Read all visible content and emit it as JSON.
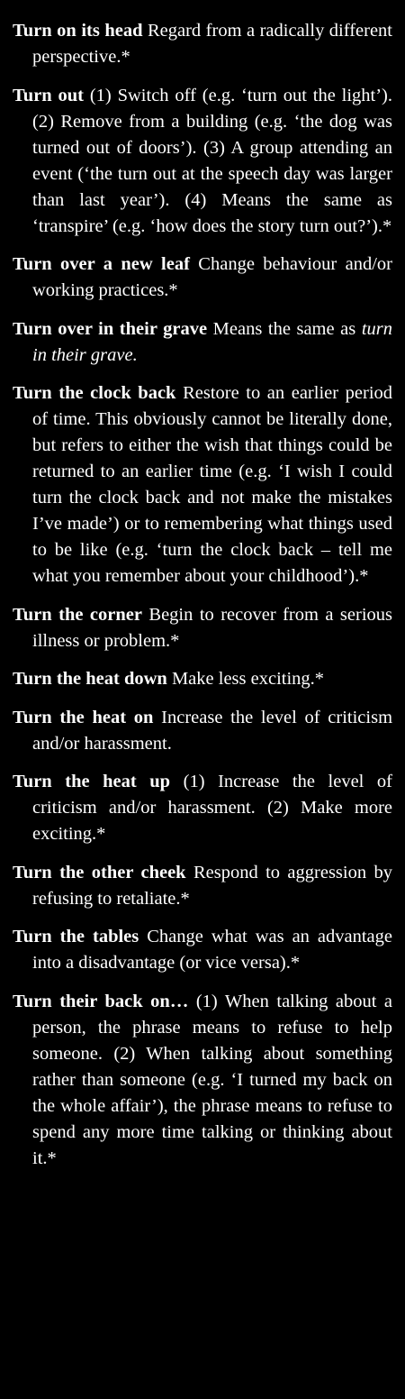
{
  "entries": [
    {
      "term": "Turn on its head",
      "definition": "Regard from a radically different perspective.*"
    },
    {
      "term": "Turn out",
      "definition": "(1) Switch off (e.g. ‘turn out the light’). (2) Remove from a building (e.g. ‘the dog was turned out of doors’). (3) A group attending an event (‘the turn out at the speech day was larger than last year’). (4) Means the same as ‘transpire’ (e.g. ‘how does the story turn out?’).*"
    },
    {
      "term": "Turn over a new leaf",
      "definition": "Change behaviour and/or working practices.*"
    },
    {
      "term": "Turn over in their grave",
      "definition": "Means the same as",
      "definition_italic": "turn in their grave.",
      "definition_after": ""
    },
    {
      "term": "Turn the clock back",
      "definition": "Restore to an earlier period of time. This obviously cannot be literally done, but refers to either the wish that things could be returned to an earlier time (e.g. ‘I wish I could turn the clock back and not make the mistakes I’ve made’) or to remembering what things used to be like (e.g. ‘turn the clock back – tell me what you remember about your childhood’).*"
    },
    {
      "term": "Turn the corner",
      "definition": "Begin to recover from a serious illness or problem.*"
    },
    {
      "term": "Turn the heat down",
      "definition": "Make less exciting.*"
    },
    {
      "term": "Turn the heat on",
      "definition": "Increase the level of criticism and/or harassment."
    },
    {
      "term": "Turn the heat up",
      "definition": "(1) Increase the level of criticism and/or harassment. (2) Make more exciting.*"
    },
    {
      "term": "Turn the other cheek",
      "definition": "Respond to aggression by refusing to retaliate.*"
    },
    {
      "term": "Turn the tables",
      "definition": "Change what was an advantage into a disadvantage (or vice versa).*"
    },
    {
      "term": "Turn their back on…",
      "definition": "(1) When talking about a person, the phrase means to refuse to help someone. (2) When talking about something rather than someone (e.g. ‘I turned my back on the whole affair’), the phrase means to refuse to spend any more time talking or thinking about it.*"
    }
  ]
}
